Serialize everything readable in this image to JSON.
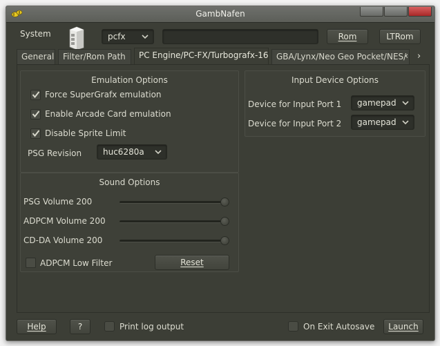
{
  "window": {
    "title": "GambNafen",
    "app_icon": "bee-icon",
    "controls": [
      "minimize",
      "maximize",
      "close"
    ]
  },
  "system_row": {
    "label": "System",
    "icon": "computer-case-icon",
    "system_select": "pcfx",
    "rom_path_value": "",
    "rom_button": "Rom",
    "ltrom_button": "LTRom"
  },
  "tabs": [
    {
      "label": "General",
      "active": false
    },
    {
      "label": "Filter/Rom Path",
      "active": false
    },
    {
      "label": "PC Engine/PC-FX/Turbografx-16",
      "active": true
    },
    {
      "label": "GBA/Lynx/Neo Geo Pocket/NES/",
      "active": false
    }
  ],
  "tab_scroll": {
    "left": "‹",
    "right": "›"
  },
  "emulation_options": {
    "title": "Emulation Options",
    "checkboxes": [
      {
        "label": "Force SuperGrafx emulation",
        "checked": true
      },
      {
        "label": "Enable Arcade Card emulation",
        "checked": true
      },
      {
        "label": "Disable Sprite Limit",
        "checked": true
      }
    ],
    "psg_revision_label": "PSG Revision",
    "psg_revision_value": "huc6280a"
  },
  "sound_options": {
    "title": "Sound Options",
    "sliders": [
      {
        "label": "PSG Volume 200",
        "value": 200,
        "max": 200
      },
      {
        "label": "ADPCM Volume 200",
        "value": 200,
        "max": 200
      },
      {
        "label": "CD-DA Volume 200",
        "value": 200,
        "max": 200
      }
    ],
    "adpcm_low_filter": {
      "label": "ADPCM Low Filter",
      "checked": false
    },
    "reset_button": "Reset"
  },
  "input_device_options": {
    "title": "Input Device Options",
    "ports": [
      {
        "label": "Device for Input Port 1",
        "value": "gamepad"
      },
      {
        "label": "Device for Input Port 2",
        "value": "gamepad"
      }
    ]
  },
  "footer": {
    "help_button": "Help",
    "question_button": "?",
    "print_log": {
      "label": "Print log output",
      "checked": false
    },
    "on_exit_autosave": {
      "label": "On Exit Autosave",
      "checked": false
    },
    "launch_button": "Launch"
  }
}
